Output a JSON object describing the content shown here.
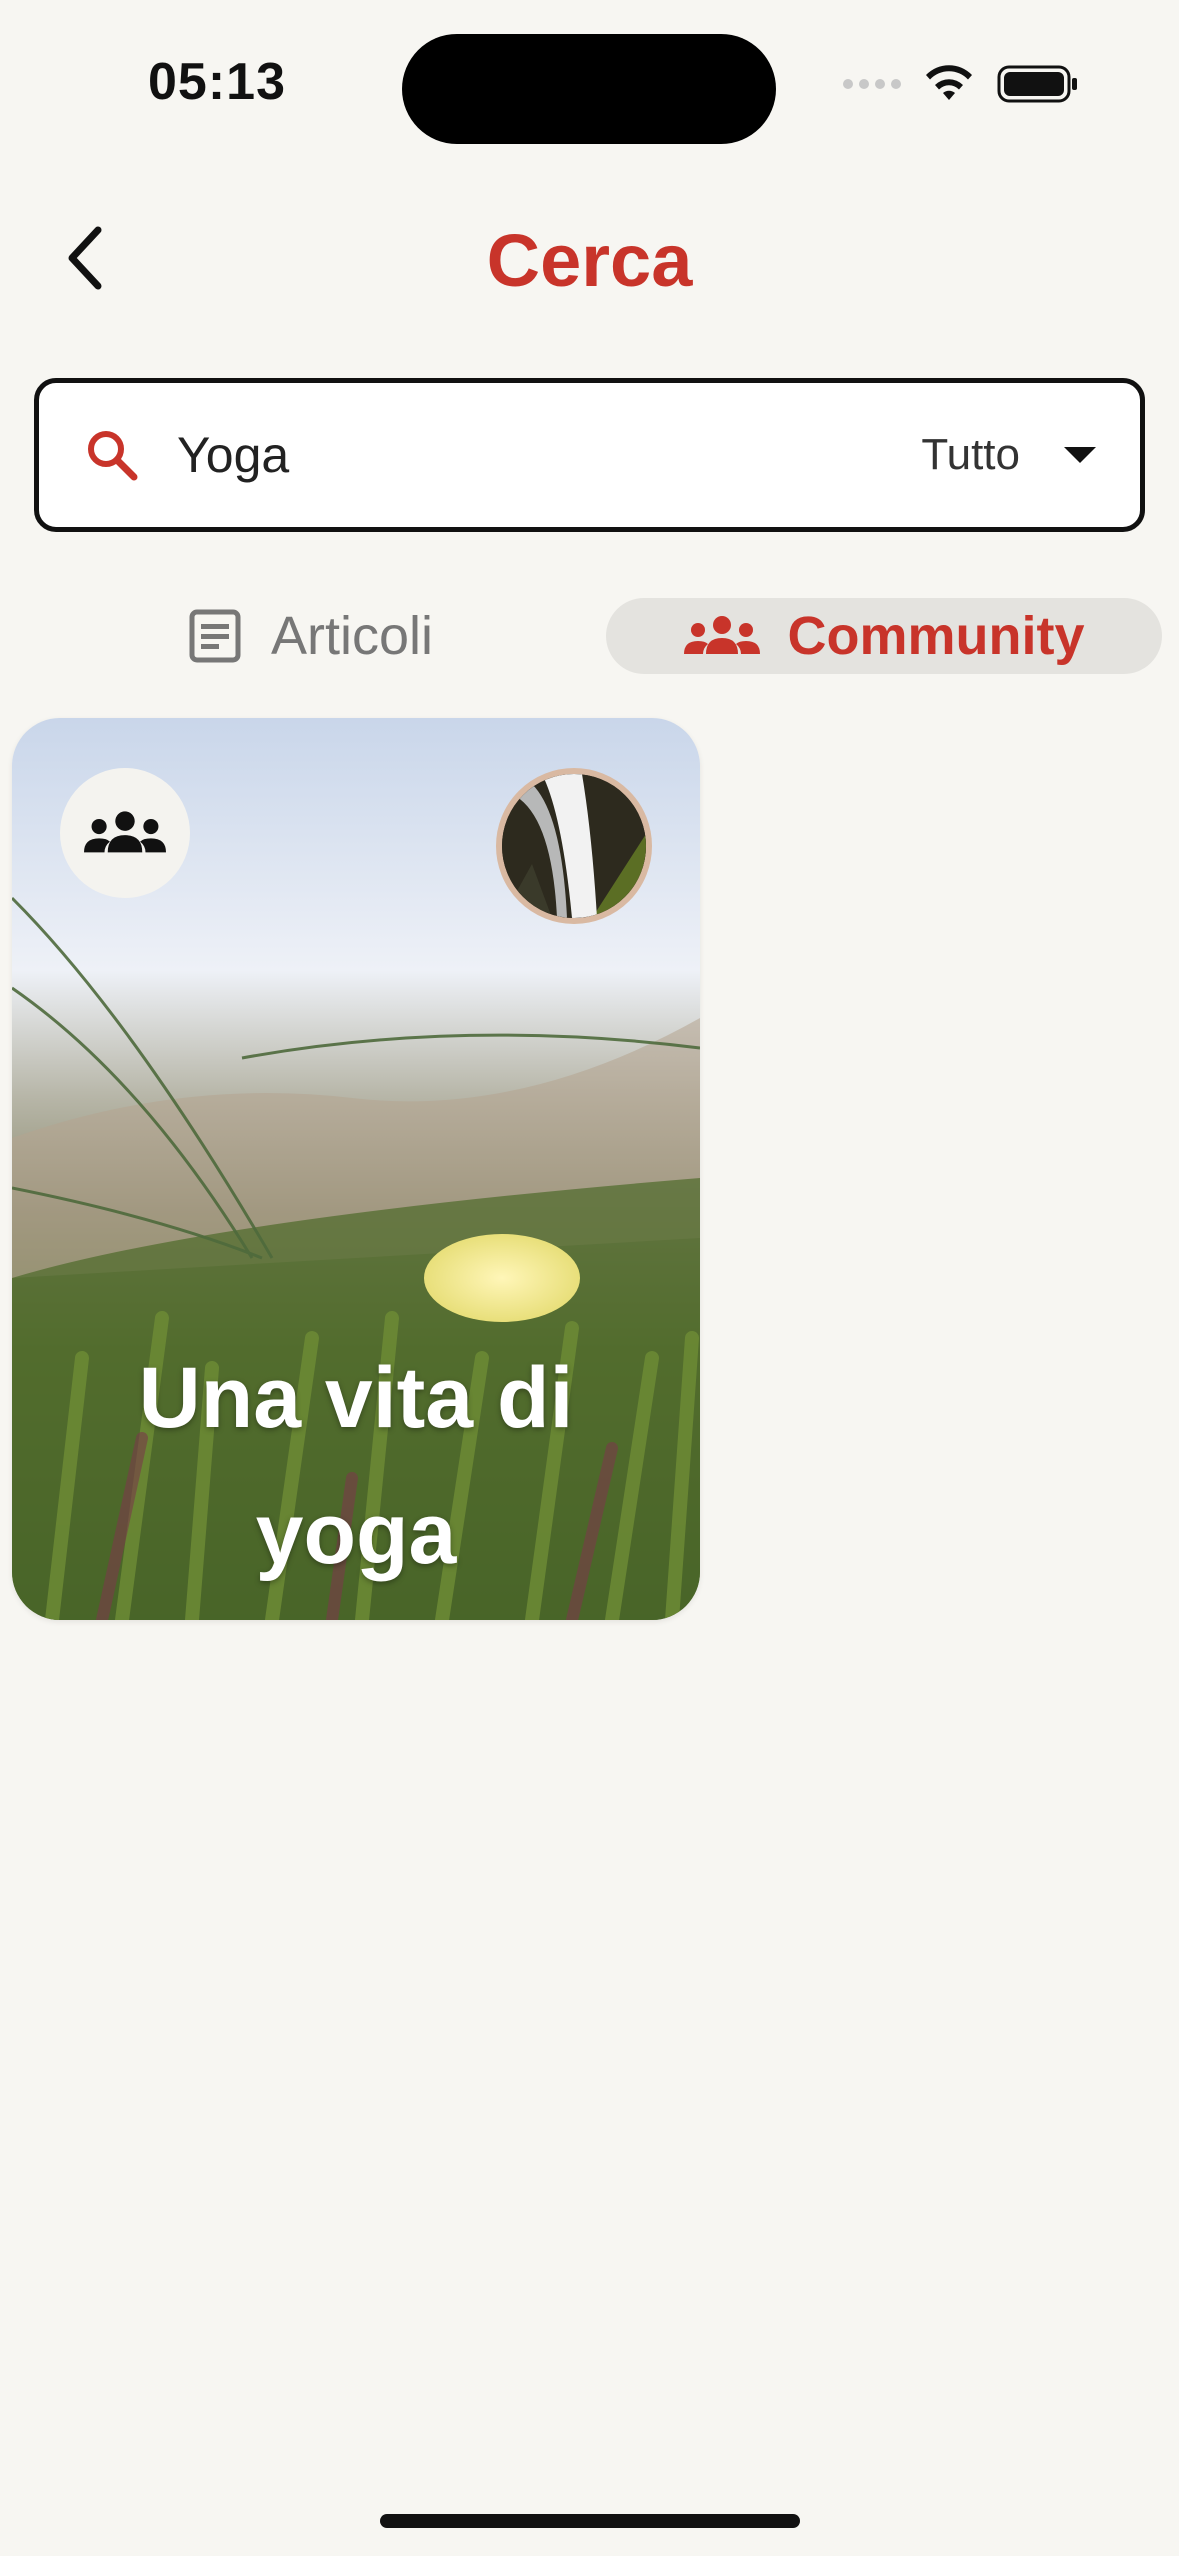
{
  "status_bar": {
    "time": "05:13"
  },
  "header": {
    "title": "Cerca"
  },
  "search": {
    "query": "Yoga",
    "filter_selected": "Tutto"
  },
  "tabs": [
    {
      "label": "Articoli",
      "icon": "article-icon",
      "active": false
    },
    {
      "label": "Community",
      "icon": "community-icon",
      "active": true
    }
  ],
  "results": [
    {
      "title": "Una vita di yoga",
      "type_icon": "community-icon",
      "avatar": "waterfall-avatar"
    }
  ],
  "colors": {
    "accent": "#c8342a",
    "background": "#f7f6f2",
    "tab_active_bg": "#e4e3df"
  }
}
